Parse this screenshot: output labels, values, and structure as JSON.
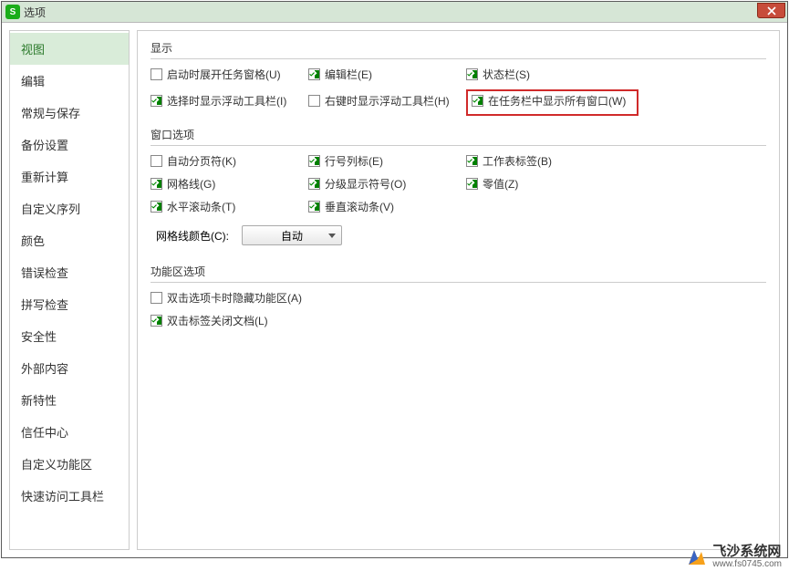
{
  "titlebar": {
    "title": "选项"
  },
  "sidebar": {
    "items": [
      "视图",
      "编辑",
      "常规与保存",
      "备份设置",
      "重新计算",
      "自定义序列",
      "颜色",
      "错误检查",
      "拼写检查",
      "安全性",
      "外部内容",
      "新特性",
      "信任中心",
      "自定义功能区",
      "快速访问工具栏"
    ],
    "active_index": 0
  },
  "sections": {
    "display": {
      "title": "显示",
      "items": [
        {
          "label": "启动时展开任务窗格(U)",
          "checked": false
        },
        {
          "label": "编辑栏(E)",
          "checked": true
        },
        {
          "label": "状态栏(S)",
          "checked": true
        },
        {
          "label": "选择时显示浮动工具栏(I)",
          "checked": true
        },
        {
          "label": "右键时显示浮动工具栏(H)",
          "checked": false
        },
        {
          "label": "在任务栏中显示所有窗口(W)",
          "checked": true,
          "highlight": true
        }
      ]
    },
    "window": {
      "title": "窗口选项",
      "items": [
        {
          "label": "自动分页符(K)",
          "checked": false
        },
        {
          "label": "行号列标(E)",
          "checked": true
        },
        {
          "label": "工作表标签(B)",
          "checked": true
        },
        {
          "label": "网格线(G)",
          "checked": true
        },
        {
          "label": "分级显示符号(O)",
          "checked": true
        },
        {
          "label": "零值(Z)",
          "checked": true
        },
        {
          "label": "水平滚动条(T)",
          "checked": true
        },
        {
          "label": "垂直滚动条(V)",
          "checked": true
        }
      ],
      "gridcolor_label": "网格线颜色(C):",
      "gridcolor_value": "自动"
    },
    "ribbon": {
      "title": "功能区选项",
      "items": [
        {
          "label": "双击选项卡时隐藏功能区(A)",
          "checked": false
        },
        {
          "label": "双击标签关闭文档(L)",
          "checked": true
        }
      ]
    }
  },
  "watermark": {
    "title": "飞沙系统网",
    "url": "www.fs0745.com"
  }
}
